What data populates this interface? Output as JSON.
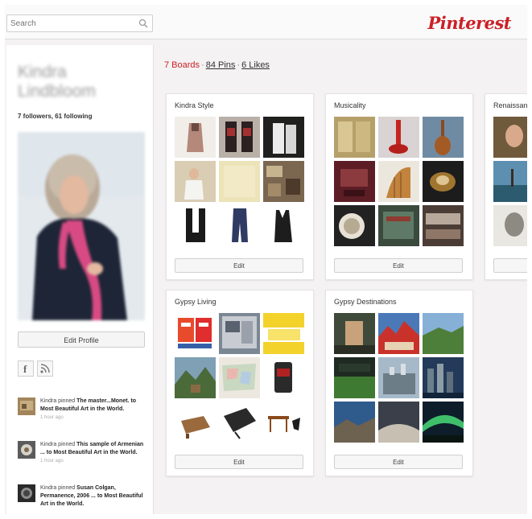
{
  "header": {
    "search_placeholder": "Search",
    "logo": "Pinterest"
  },
  "profile": {
    "name": "Kindra Lindbloom",
    "stats": "7 followers, 61 following",
    "edit_profile": "Edit Profile"
  },
  "activity": [
    {
      "text_pre": "Kindra pinned ",
      "text_bold": "The master...Monet. to Most Beautiful Art in the World.",
      "time": "1 hour ago"
    },
    {
      "text_pre": "Kindra pinned ",
      "text_bold": "This sample of Armenian ... to Most Beautiful Art in the World.",
      "time": "1 hour ago"
    },
    {
      "text_pre": "Kindra pinned ",
      "text_bold": "Susan Colgan, Permanence, 2006 ... to Most Beautiful Art in the World.",
      "time": ""
    }
  ],
  "tabs": {
    "boards": "7 Boards",
    "pins": "84 Pins",
    "likes": "6 Likes"
  },
  "boards": [
    {
      "title": "Kindra Style",
      "edit": "Edit"
    },
    {
      "title": "Musicality",
      "edit": "Edit"
    },
    {
      "title": "Renaissance",
      "edit": ""
    },
    {
      "title": "Gypsy Living",
      "edit": "Edit"
    },
    {
      "title": "Gypsy Destinations",
      "edit": "Edit"
    }
  ],
  "colors": {
    "brand": "#cb2027",
    "background": "#f4f2f2"
  }
}
